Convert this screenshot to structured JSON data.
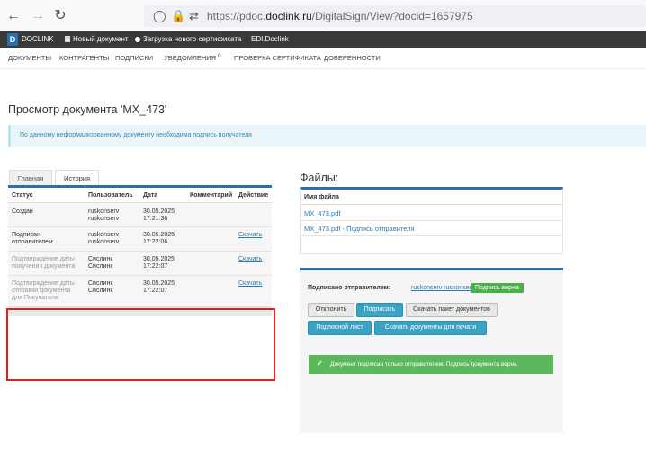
{
  "browser": {
    "url_prefix": "https://pdoc.",
    "url_domain": "doclink.ru",
    "url_path": "/DigitalSign/View?docid=1657975"
  },
  "appbar": {
    "logo_letter": "D",
    "logo_text": "DOCLINK",
    "new_doc": "Новый документ",
    "upload_cert": "Загрузка нового сертификата",
    "edi": "EDI.Doclink"
  },
  "nav": {
    "documents": "ДОКУМЕНТЫ",
    "contractors": "КОНТРАГЕНТЫ",
    "subscriptions": "ПОДПИСКИ",
    "notifications": "УВЕДОМЛЕНИЯ",
    "notifications_count": "0",
    "cert_check": "ПРОВЕРКА СЕРТИФИКАТА",
    "powers": "ДОВЕРЕННОСТИ"
  },
  "page": {
    "title": "Просмотр документа 'MX_473'",
    "info": "По данному неформализованному документу необходима подпись получателя"
  },
  "tabs": {
    "main": "Главная",
    "history": "История"
  },
  "history": {
    "headers": {
      "status": "Статус",
      "user": "Пользователь",
      "date": "Дата",
      "comment": "Комментарий",
      "action": "Действие"
    },
    "rows": [
      {
        "status_1": "Создан",
        "status_2": "",
        "status_3": "",
        "user_1": "ruskonserv",
        "user_2": "ruskonserv",
        "date": "30.05.2025",
        "time": "17:21:36",
        "action": ""
      },
      {
        "status_1": "Подписан",
        "status_2": "отправителем",
        "status_3": "",
        "user_1": "ruskonserv",
        "user_2": "ruskonserv",
        "date": "30.05.2025",
        "time": "17:22:06",
        "action": "Скачать"
      },
      {
        "status_1": "Подтверждение даты",
        "status_2": "получения документа",
        "status_3": "",
        "user_1": "Сислинк",
        "user_2": "Сислинк",
        "date": "30.05.2025",
        "time": "17:22:07",
        "action": "Скачать"
      },
      {
        "status_1": "Подтверждение даты",
        "status_2": "отправки документа",
        "status_3": "для Покупателя",
        "user_1": "Сислинк",
        "user_2": "Сислинк",
        "date": "30.05.2025",
        "time": "17:22:07",
        "action": "Скачать"
      }
    ]
  },
  "files": {
    "title": "Файлы:",
    "header": "Имя файла",
    "items": [
      "MX_473.pdf",
      "MX_473.pdf - Подпись отправителя"
    ]
  },
  "sign": {
    "label": "Подписано отправителем:",
    "user": "ruskonserv ruskonserv",
    "badge": "Подпись верна",
    "btn_reject": "Отклонить",
    "btn_sign": "Подписать",
    "btn_download_pack": "Скачать пакет документов",
    "btn_sign_sheet": "Подписной лист",
    "btn_download_print": "Скачать документы для печати",
    "success": "Документ подписан только отправителем. Подпись документа верна"
  }
}
